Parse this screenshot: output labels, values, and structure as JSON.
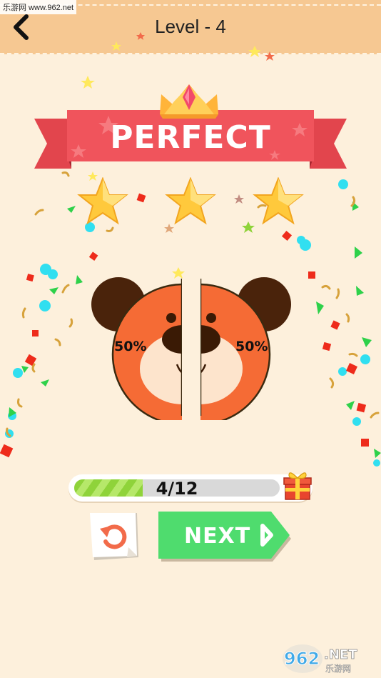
{
  "header": {
    "title": "Level - 4",
    "back_icon": "chevron-left-icon"
  },
  "watermark": {
    "top_text": "乐游网 www.962.net",
    "bottom_logo_text": "962.NET",
    "bottom_logo_sub": "乐游网"
  },
  "result": {
    "banner_text": "PERFECT",
    "stars_earned": 3,
    "stars_total": 3
  },
  "puzzle": {
    "left_half_percent": "50%",
    "right_half_percent": "50%"
  },
  "progress": {
    "text": "4/12",
    "current": 4,
    "total": 12
  },
  "actions": {
    "restart_icon": "restart-icon",
    "next_label": "NEXT",
    "gift_icon": "gift-icon"
  },
  "colors": {
    "background": "#fdf0dc",
    "header": "#f6c892",
    "ribbon": "#f0545c",
    "star": "#ffc93c",
    "bear_face": "#f56b35",
    "bear_ear": "#4a230b",
    "next_button": "#4fdc6e",
    "progress_fill": "#8fd33a"
  }
}
